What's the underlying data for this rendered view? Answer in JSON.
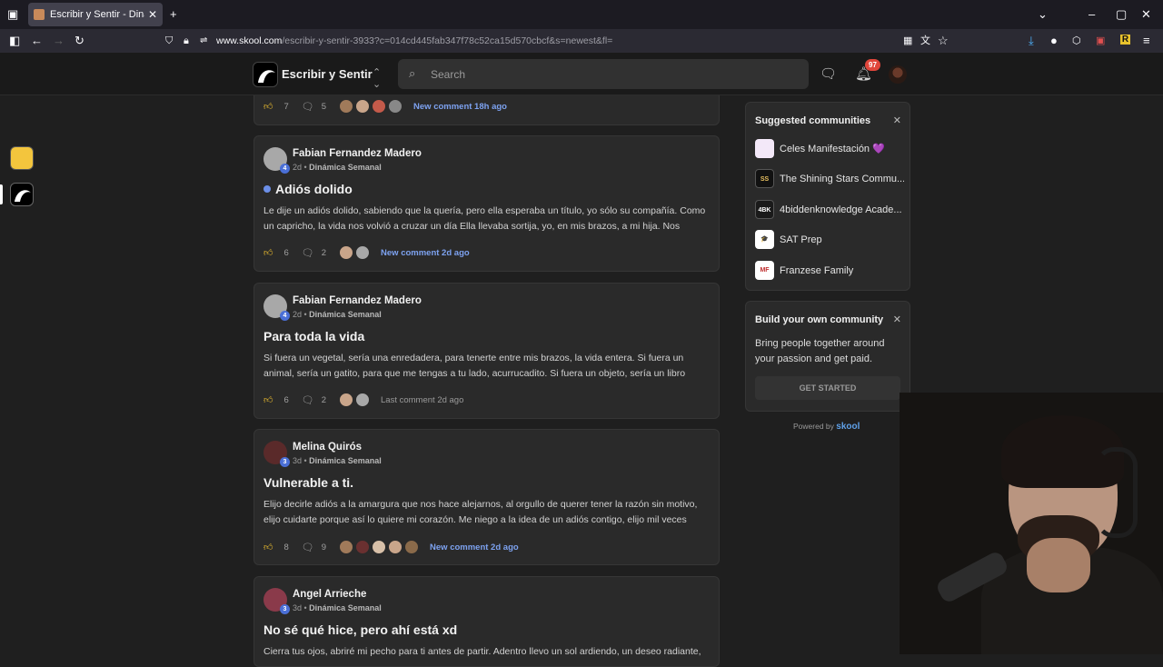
{
  "browser": {
    "tab_title": "Escribir y Sentir - Dinámica Semanal",
    "url_domain": "www.skool.com",
    "url_path": "/escribir-y-sentir-3933?c=014cd445fab347f78c52ca15d570cbcf&s=newest&fl="
  },
  "header": {
    "group_name": "Escribir y Sentir",
    "search_placeholder": "Search",
    "notif_count": "97"
  },
  "top_partial": {
    "likes": "7",
    "comments": "5",
    "activity": "New comment 18h ago"
  },
  "posts": [
    {
      "author": "Fabian Fernandez Madero",
      "level": "4",
      "age": "2d",
      "category": "Dinámica Semanal",
      "title": "Adiós dolido",
      "unread": true,
      "body": "Le dije un adiós dolido, sabiendo que la quería, pero ella esperaba un título, yo sólo su compañía. Como un capricho, la vida nos volvió a cruzar un día Ella llevaba sortija, yo, en mis brazos, a mi hija. Nos",
      "likes": "6",
      "comments": "2",
      "activity": "New comment 2d ago",
      "activity_new": true
    },
    {
      "author": "Fabian Fernandez Madero",
      "level": "4",
      "age": "2d",
      "category": "Dinámica Semanal",
      "title": "Para toda la vida",
      "unread": false,
      "body": "Si fuera un vegetal, sería una enredadera, para tenerte entre mis brazos, la vida entera. Si fuera un animal, sería un gatito, para que me tengas a tu lado, acurrucadito. Si fuera un objeto, sería un libro",
      "likes": "6",
      "comments": "2",
      "activity": "Last comment 2d ago",
      "activity_new": false
    },
    {
      "author": "Melina Quirós",
      "level": "3",
      "age": "3d",
      "category": "Dinámica Semanal",
      "title": "Vulnerable a ti.",
      "unread": false,
      "body": "Elijo decirle adiós a la amargura que nos hace alejarnos, al orgullo de querer tener la razón sin motivo, elijo cuidarte porque así lo quiere mi corazón. Me niego a la idea de un adiós contigo, elijo mil veces",
      "likes": "8",
      "comments": "9",
      "activity": "New comment 2d ago",
      "activity_new": true
    },
    {
      "author": "Angel Arrieche",
      "level": "3",
      "age": "3d",
      "category": "Dinámica Semanal",
      "title": "No sé qué hice, pero ahí está xd",
      "unread": false,
      "body": "Cierra tus ojos, abriré mi pecho para ti antes de partir. Adentro llevo un sol ardiendo, un deseo radiante,"
    }
  ],
  "suggested": {
    "title": "Suggested communities",
    "items": [
      {
        "name": "Celes Manifestación 💜",
        "icon_label": "",
        "icon_color": "#f3e8f8"
      },
      {
        "name": "The Shining Stars Commu...",
        "icon_label": "SS",
        "icon_color": "#111111"
      },
      {
        "name": "4biddenknowledge Acade...",
        "icon_label": "4BK",
        "icon_color": "#1a1a1a"
      },
      {
        "name": "SAT Prep",
        "icon_label": "🎓",
        "icon_color": "#ffffff"
      },
      {
        "name": "Franzese Family",
        "icon_label": "MF",
        "icon_color": "#ffffff"
      }
    ]
  },
  "build": {
    "title": "Build your own community",
    "text": "Bring people together around your passion and get paid.",
    "button": "GET STARTED"
  },
  "powered": {
    "label": "Powered by",
    "brand": "skool"
  },
  "colors": {
    "accent_blue": "#7da2f0",
    "like_yellow": "#f2c230",
    "badge_red": "#e0463b"
  }
}
